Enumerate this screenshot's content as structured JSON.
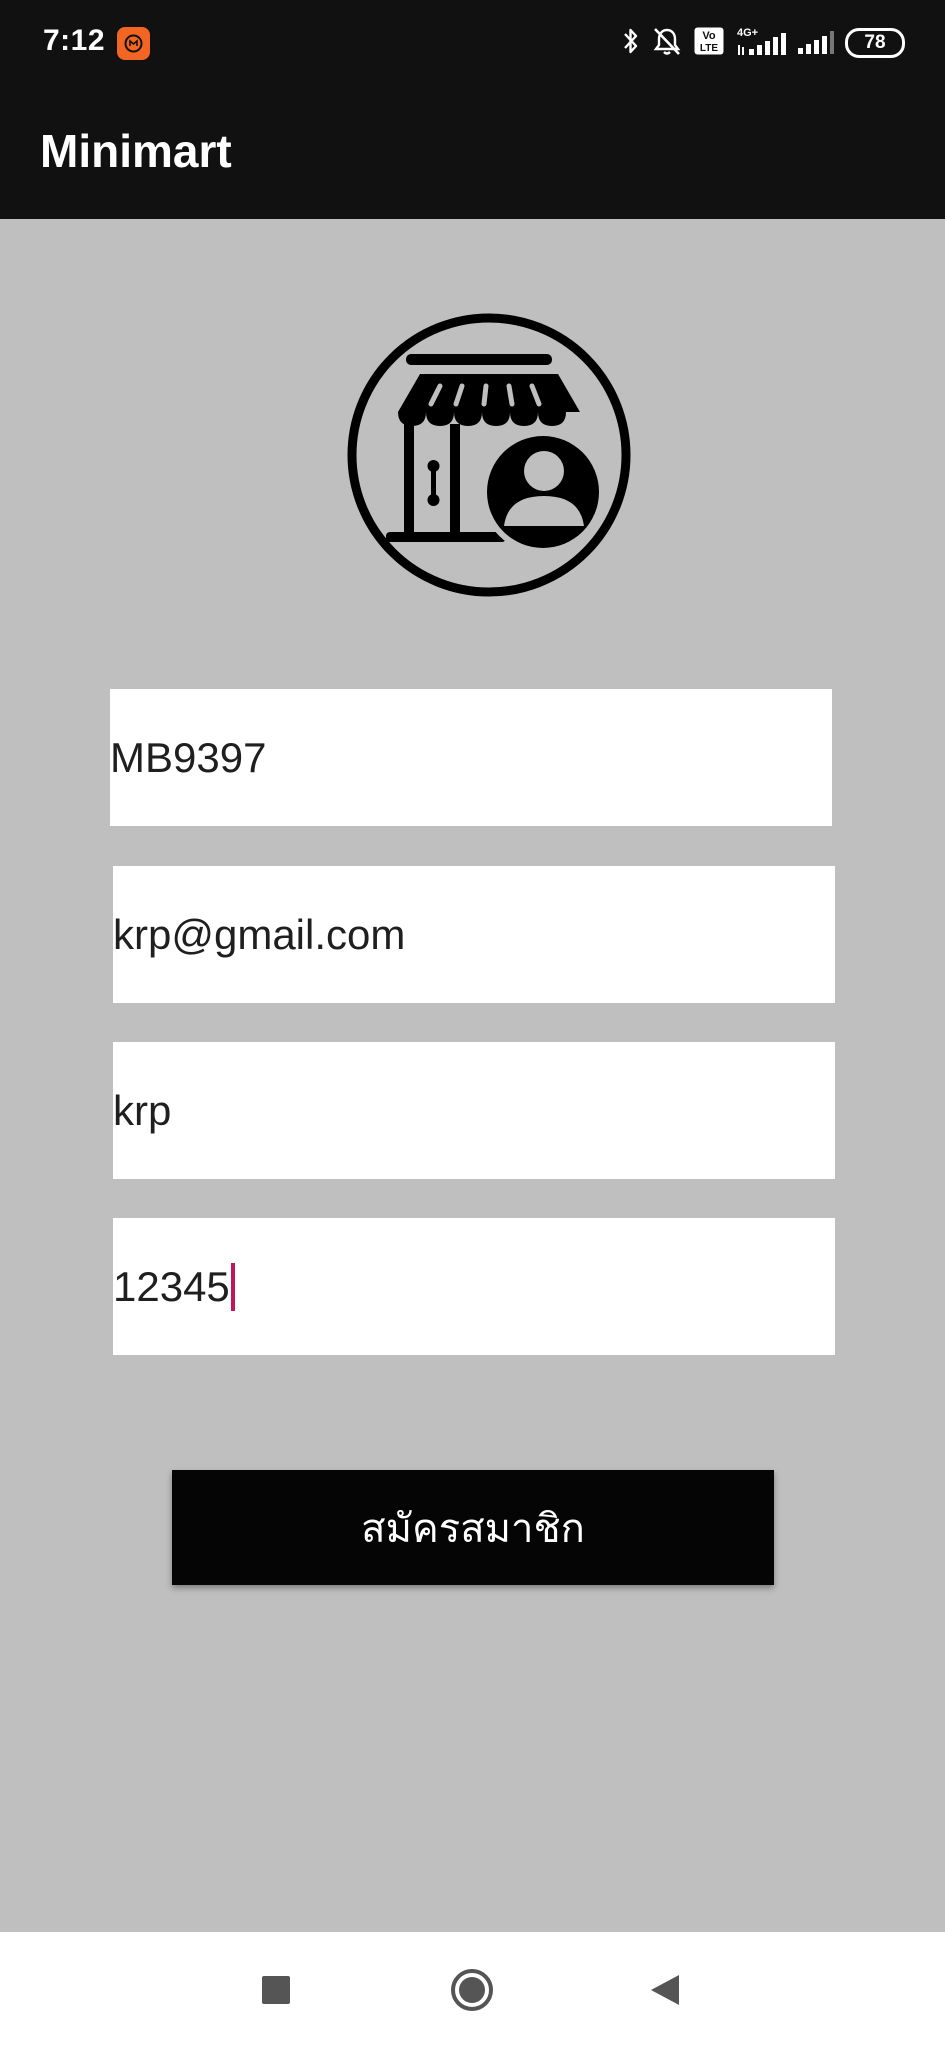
{
  "status_bar": {
    "time": "7:12",
    "battery": "78",
    "icons": [
      "mi-app-icon",
      "bluetooth-icon",
      "alarm-off-icon",
      "volte-icon",
      "signal-4g-icon",
      "signal-icon",
      "battery-icon"
    ],
    "network_label": "4G+",
    "volte_label": "Vo LTE"
  },
  "app_bar": {
    "title": "Minimart"
  },
  "logo": {
    "icon": "store-user-icon"
  },
  "form": {
    "member_id": "MB9397",
    "email": "krp@gmail.com",
    "name": "krp",
    "password": "12345"
  },
  "register_button": {
    "label": "สมัครสมาชิก"
  },
  "nav_bar": {
    "icons": [
      "recent-apps-icon",
      "home-icon",
      "back-icon"
    ]
  },
  "colors": {
    "background": "#bfbfbf",
    "app_bar": "#111111",
    "button": "#050505",
    "caret": "#c2185b"
  }
}
